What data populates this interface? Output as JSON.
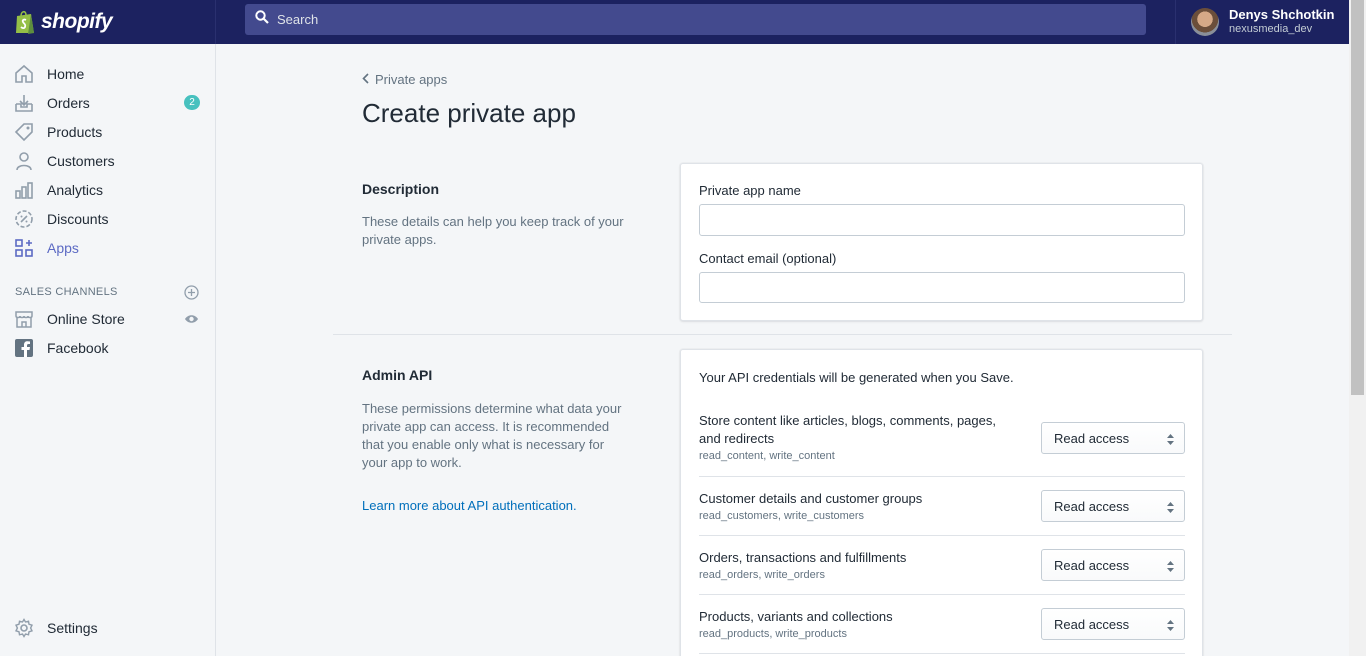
{
  "brand": {
    "name": "shopify"
  },
  "search": {
    "placeholder": "Search"
  },
  "user": {
    "name": "Denys Shchotkin",
    "store": "nexusmedia_dev"
  },
  "sidebar": {
    "items": [
      {
        "label": "Home",
        "icon": "home-icon"
      },
      {
        "label": "Orders",
        "icon": "orders-icon",
        "badge": "2"
      },
      {
        "label": "Products",
        "icon": "tag-icon"
      },
      {
        "label": "Customers",
        "icon": "person-icon"
      },
      {
        "label": "Analytics",
        "icon": "bar-chart-icon"
      },
      {
        "label": "Discounts",
        "icon": "discount-icon"
      },
      {
        "label": "Apps",
        "icon": "apps-icon",
        "active": true
      }
    ],
    "channels_header": "SALES CHANNELS",
    "channels": [
      {
        "label": "Online Store",
        "icon": "store-icon"
      },
      {
        "label": "Facebook",
        "icon": "facebook-icon"
      }
    ],
    "settings": {
      "label": "Settings",
      "icon": "gear-icon"
    }
  },
  "breadcrumb": {
    "label": "Private apps"
  },
  "page": {
    "title": "Create private app"
  },
  "description": {
    "title": "Description",
    "text": "These details can help you keep track of your private apps.",
    "name_label": "Private app name",
    "name_value": "",
    "email_label": "Contact email (optional)",
    "email_value": ""
  },
  "admin_api": {
    "title": "Admin API",
    "text": "These permissions determine what data your private app can access. It is recommended that you enable only what is necessary for your app to work.",
    "link": "Learn more about API authentication.",
    "intro": "Your API credentials will be generated when you Save.",
    "permissions": [
      {
        "title": "Store content like articles, blogs, comments, pages, and redirects",
        "scopes": "read_content, write_content",
        "access": "Read access"
      },
      {
        "title": "Customer details and customer groups",
        "scopes": "read_customers, write_customers",
        "access": "Read access"
      },
      {
        "title": "Orders, transactions and fulfillments",
        "scopes": "read_orders, write_orders",
        "access": "Read access"
      },
      {
        "title": "Products, variants and collections",
        "scopes": "read_products, write_products",
        "access": "Read access"
      }
    ]
  },
  "colors": {
    "topbar": "#1c2260",
    "accent": "#5c6ac4",
    "badge": "#47c1bf",
    "link": "#006fbb"
  }
}
